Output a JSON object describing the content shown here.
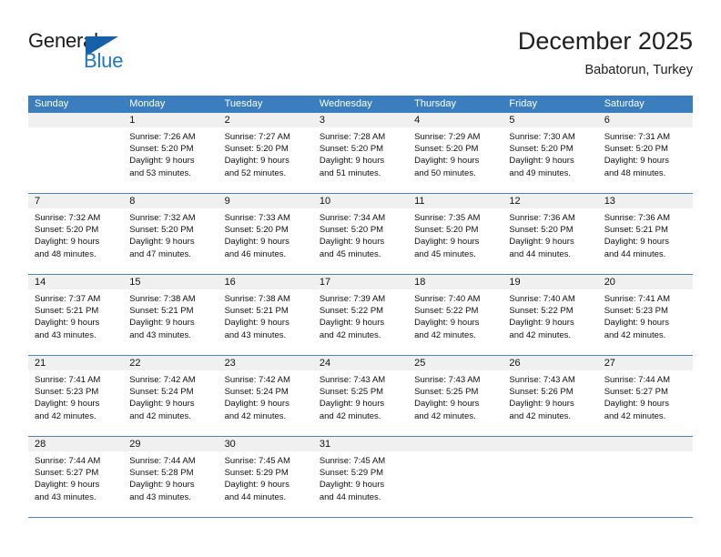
{
  "brand": {
    "word_one": "General",
    "word_two": "Blue",
    "triangle_icon": "triangle-right-icon",
    "primary_color": "#1560a8",
    "accent_color": "#1f77bf"
  },
  "header": {
    "title": "December 2025",
    "location": "Babatorun, Turkey"
  },
  "theme": {
    "header_band": "#3b7ebf",
    "daynum_band": "#f0f0f0",
    "row_divider": "#4a86c5",
    "text": "#111111"
  },
  "weekdays": [
    "Sunday",
    "Monday",
    "Tuesday",
    "Wednesday",
    "Thursday",
    "Friday",
    "Saturday"
  ],
  "weeks": [
    {
      "days": [
        {
          "date": "",
          "sunrise": "",
          "sunset": "",
          "daylight_a": "",
          "daylight_b": "",
          "empty": true
        },
        {
          "date": "1",
          "sunrise": "Sunrise: 7:26 AM",
          "sunset": "Sunset: 5:20 PM",
          "daylight_a": "Daylight: 9 hours",
          "daylight_b": "and 53 minutes.",
          "empty": false
        },
        {
          "date": "2",
          "sunrise": "Sunrise: 7:27 AM",
          "sunset": "Sunset: 5:20 PM",
          "daylight_a": "Daylight: 9 hours",
          "daylight_b": "and 52 minutes.",
          "empty": false
        },
        {
          "date": "3",
          "sunrise": "Sunrise: 7:28 AM",
          "sunset": "Sunset: 5:20 PM",
          "daylight_a": "Daylight: 9 hours",
          "daylight_b": "and 51 minutes.",
          "empty": false
        },
        {
          "date": "4",
          "sunrise": "Sunrise: 7:29 AM",
          "sunset": "Sunset: 5:20 PM",
          "daylight_a": "Daylight: 9 hours",
          "daylight_b": "and 50 minutes.",
          "empty": false
        },
        {
          "date": "5",
          "sunrise": "Sunrise: 7:30 AM",
          "sunset": "Sunset: 5:20 PM",
          "daylight_a": "Daylight: 9 hours",
          "daylight_b": "and 49 minutes.",
          "empty": false
        },
        {
          "date": "6",
          "sunrise": "Sunrise: 7:31 AM",
          "sunset": "Sunset: 5:20 PM",
          "daylight_a": "Daylight: 9 hours",
          "daylight_b": "and 48 minutes.",
          "empty": false
        }
      ]
    },
    {
      "days": [
        {
          "date": "7",
          "sunrise": "Sunrise: 7:32 AM",
          "sunset": "Sunset: 5:20 PM",
          "daylight_a": "Daylight: 9 hours",
          "daylight_b": "and 48 minutes.",
          "empty": false
        },
        {
          "date": "8",
          "sunrise": "Sunrise: 7:32 AM",
          "sunset": "Sunset: 5:20 PM",
          "daylight_a": "Daylight: 9 hours",
          "daylight_b": "and 47 minutes.",
          "empty": false
        },
        {
          "date": "9",
          "sunrise": "Sunrise: 7:33 AM",
          "sunset": "Sunset: 5:20 PM",
          "daylight_a": "Daylight: 9 hours",
          "daylight_b": "and 46 minutes.",
          "empty": false
        },
        {
          "date": "10",
          "sunrise": "Sunrise: 7:34 AM",
          "sunset": "Sunset: 5:20 PM",
          "daylight_a": "Daylight: 9 hours",
          "daylight_b": "and 45 minutes.",
          "empty": false
        },
        {
          "date": "11",
          "sunrise": "Sunrise: 7:35 AM",
          "sunset": "Sunset: 5:20 PM",
          "daylight_a": "Daylight: 9 hours",
          "daylight_b": "and 45 minutes.",
          "empty": false
        },
        {
          "date": "12",
          "sunrise": "Sunrise: 7:36 AM",
          "sunset": "Sunset: 5:20 PM",
          "daylight_a": "Daylight: 9 hours",
          "daylight_b": "and 44 minutes.",
          "empty": false
        },
        {
          "date": "13",
          "sunrise": "Sunrise: 7:36 AM",
          "sunset": "Sunset: 5:21 PM",
          "daylight_a": "Daylight: 9 hours",
          "daylight_b": "and 44 minutes.",
          "empty": false
        }
      ]
    },
    {
      "days": [
        {
          "date": "14",
          "sunrise": "Sunrise: 7:37 AM",
          "sunset": "Sunset: 5:21 PM",
          "daylight_a": "Daylight: 9 hours",
          "daylight_b": "and 43 minutes.",
          "empty": false
        },
        {
          "date": "15",
          "sunrise": "Sunrise: 7:38 AM",
          "sunset": "Sunset: 5:21 PM",
          "daylight_a": "Daylight: 9 hours",
          "daylight_b": "and 43 minutes.",
          "empty": false
        },
        {
          "date": "16",
          "sunrise": "Sunrise: 7:38 AM",
          "sunset": "Sunset: 5:21 PM",
          "daylight_a": "Daylight: 9 hours",
          "daylight_b": "and 43 minutes.",
          "empty": false
        },
        {
          "date": "17",
          "sunrise": "Sunrise: 7:39 AM",
          "sunset": "Sunset: 5:22 PM",
          "daylight_a": "Daylight: 9 hours",
          "daylight_b": "and 42 minutes.",
          "empty": false
        },
        {
          "date": "18",
          "sunrise": "Sunrise: 7:40 AM",
          "sunset": "Sunset: 5:22 PM",
          "daylight_a": "Daylight: 9 hours",
          "daylight_b": "and 42 minutes.",
          "empty": false
        },
        {
          "date": "19",
          "sunrise": "Sunrise: 7:40 AM",
          "sunset": "Sunset: 5:22 PM",
          "daylight_a": "Daylight: 9 hours",
          "daylight_b": "and 42 minutes.",
          "empty": false
        },
        {
          "date": "20",
          "sunrise": "Sunrise: 7:41 AM",
          "sunset": "Sunset: 5:23 PM",
          "daylight_a": "Daylight: 9 hours",
          "daylight_b": "and 42 minutes.",
          "empty": false
        }
      ]
    },
    {
      "days": [
        {
          "date": "21",
          "sunrise": "Sunrise: 7:41 AM",
          "sunset": "Sunset: 5:23 PM",
          "daylight_a": "Daylight: 9 hours",
          "daylight_b": "and 42 minutes.",
          "empty": false
        },
        {
          "date": "22",
          "sunrise": "Sunrise: 7:42 AM",
          "sunset": "Sunset: 5:24 PM",
          "daylight_a": "Daylight: 9 hours",
          "daylight_b": "and 42 minutes.",
          "empty": false
        },
        {
          "date": "23",
          "sunrise": "Sunrise: 7:42 AM",
          "sunset": "Sunset: 5:24 PM",
          "daylight_a": "Daylight: 9 hours",
          "daylight_b": "and 42 minutes.",
          "empty": false
        },
        {
          "date": "24",
          "sunrise": "Sunrise: 7:43 AM",
          "sunset": "Sunset: 5:25 PM",
          "daylight_a": "Daylight: 9 hours",
          "daylight_b": "and 42 minutes.",
          "empty": false
        },
        {
          "date": "25",
          "sunrise": "Sunrise: 7:43 AM",
          "sunset": "Sunset: 5:25 PM",
          "daylight_a": "Daylight: 9 hours",
          "daylight_b": "and 42 minutes.",
          "empty": false
        },
        {
          "date": "26",
          "sunrise": "Sunrise: 7:43 AM",
          "sunset": "Sunset: 5:26 PM",
          "daylight_a": "Daylight: 9 hours",
          "daylight_b": "and 42 minutes.",
          "empty": false
        },
        {
          "date": "27",
          "sunrise": "Sunrise: 7:44 AM",
          "sunset": "Sunset: 5:27 PM",
          "daylight_a": "Daylight: 9 hours",
          "daylight_b": "and 42 minutes.",
          "empty": false
        }
      ]
    },
    {
      "days": [
        {
          "date": "28",
          "sunrise": "Sunrise: 7:44 AM",
          "sunset": "Sunset: 5:27 PM",
          "daylight_a": "Daylight: 9 hours",
          "daylight_b": "and 43 minutes.",
          "empty": false
        },
        {
          "date": "29",
          "sunrise": "Sunrise: 7:44 AM",
          "sunset": "Sunset: 5:28 PM",
          "daylight_a": "Daylight: 9 hours",
          "daylight_b": "and 43 minutes.",
          "empty": false
        },
        {
          "date": "30",
          "sunrise": "Sunrise: 7:45 AM",
          "sunset": "Sunset: 5:29 PM",
          "daylight_a": "Daylight: 9 hours",
          "daylight_b": "and 44 minutes.",
          "empty": false
        },
        {
          "date": "31",
          "sunrise": "Sunrise: 7:45 AM",
          "sunset": "Sunset: 5:29 PM",
          "daylight_a": "Daylight: 9 hours",
          "daylight_b": "and 44 minutes.",
          "empty": false
        },
        {
          "date": "",
          "sunrise": "",
          "sunset": "",
          "daylight_a": "",
          "daylight_b": "",
          "empty": true
        },
        {
          "date": "",
          "sunrise": "",
          "sunset": "",
          "daylight_a": "",
          "daylight_b": "",
          "empty": true
        },
        {
          "date": "",
          "sunrise": "",
          "sunset": "",
          "daylight_a": "",
          "daylight_b": "",
          "empty": true
        }
      ]
    }
  ]
}
